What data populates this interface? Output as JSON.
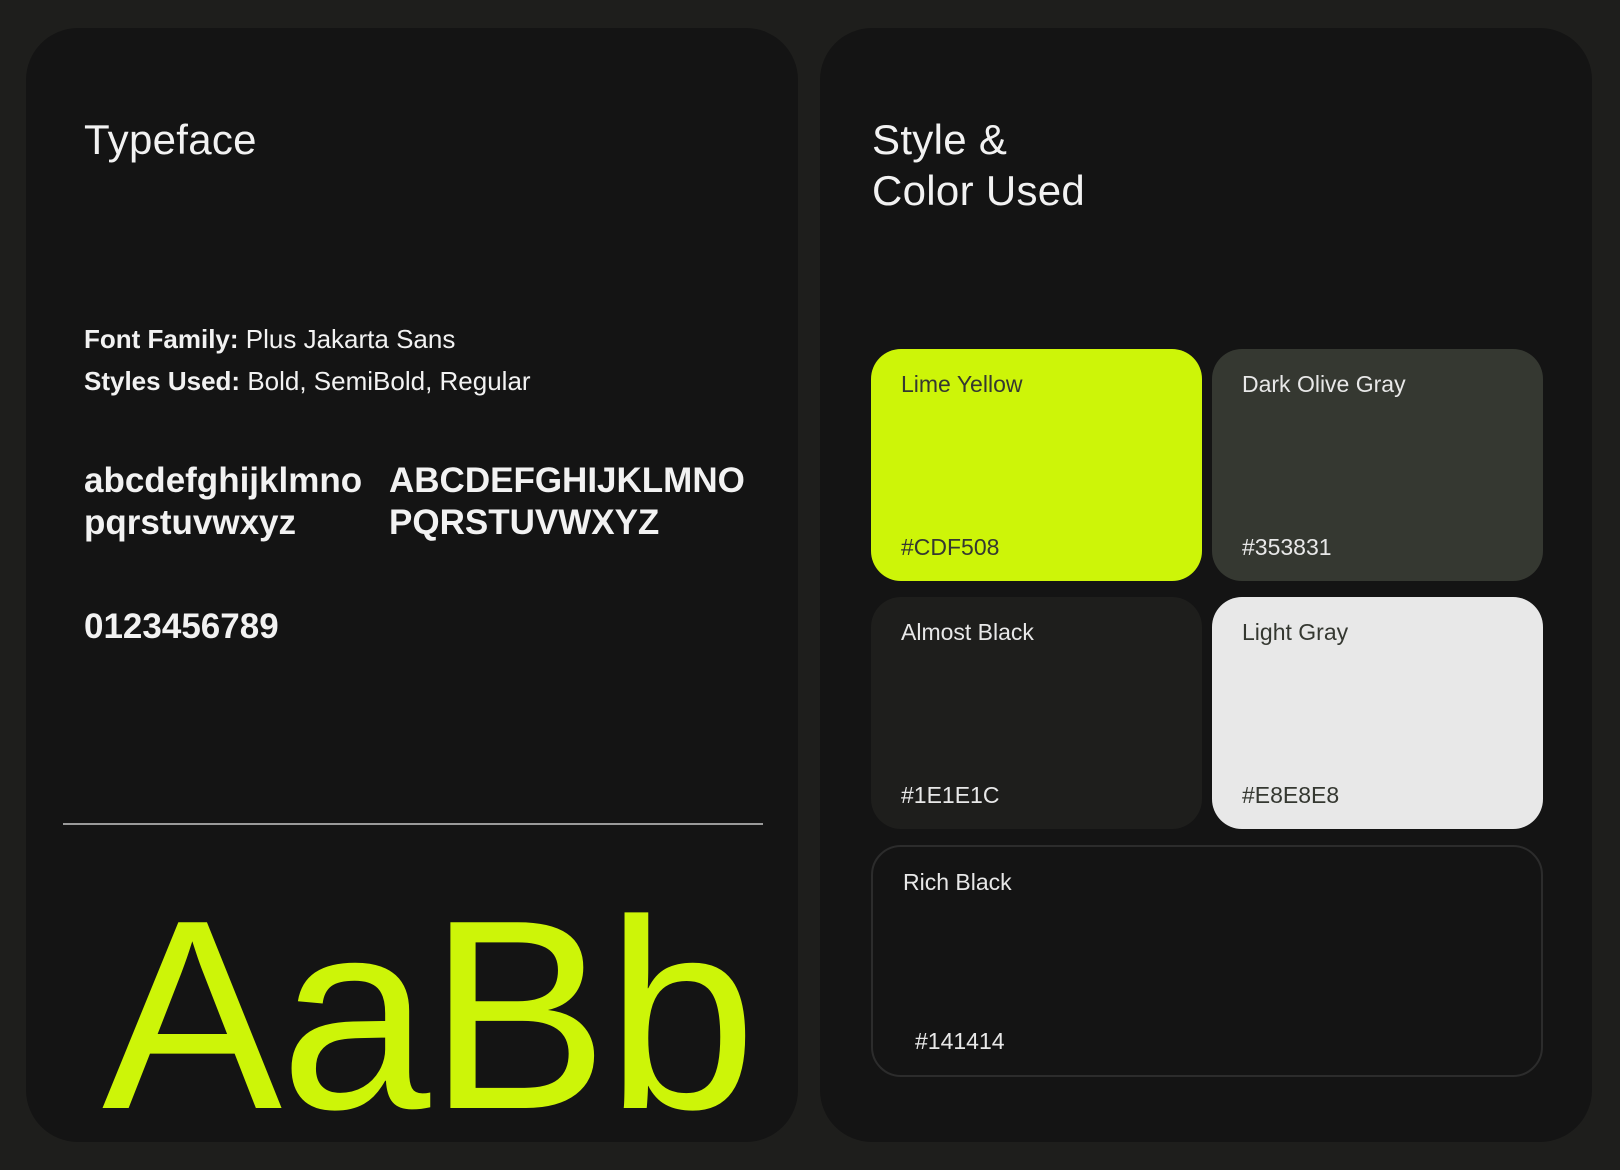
{
  "typeface": {
    "heading": "Typeface",
    "font_family_label": "Font Family:",
    "font_family_value": "Plus Jakarta Sans",
    "styles_label": "Styles Used:",
    "styles_value": "Bold, SemiBold, Regular",
    "lowercase_line1": "abcdefghijklmno",
    "lowercase_line2": "pqrstuvwxyz",
    "uppercase_line1": "ABCDEFGHIJKLMNO",
    "uppercase_line2": "PQRSTUVWXYZ",
    "digits": "0123456789",
    "specimen": "AaBb",
    "accent_color": "#CDF508"
  },
  "colors": {
    "heading_line1": "Style &",
    "heading_line2": "Color Used",
    "swatches": [
      {
        "name": "Lime Yellow",
        "hex": "#CDF508"
      },
      {
        "name": "Dark Olive Gray",
        "hex": "#353831"
      },
      {
        "name": "Almost Black",
        "hex": "#1E1E1C"
      },
      {
        "name": "Light Gray",
        "hex": "#E8E8E8"
      },
      {
        "name": "Rich Black",
        "hex": "#141414"
      }
    ]
  }
}
